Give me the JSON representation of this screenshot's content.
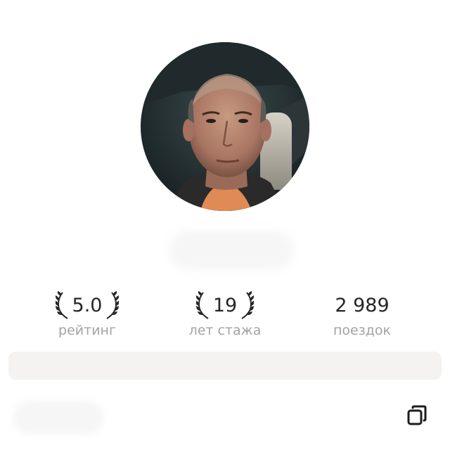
{
  "profile": {
    "avatar_icon": "driver-photo",
    "name": ""
  },
  "stats": {
    "rating": {
      "value": "5.0",
      "label": "рейтинг",
      "icon": "laurel-icon"
    },
    "experience": {
      "value": "19",
      "label": "лет стажа",
      "icon": "laurel-icon"
    },
    "trips": {
      "value": "2 989",
      "label": "поездок"
    }
  },
  "actions": {
    "copy_icon": "copy-icon"
  },
  "colors": {
    "text_primary": "#262626",
    "text_secondary": "#a3a3a3",
    "info_bar": "#f4f3f1"
  }
}
